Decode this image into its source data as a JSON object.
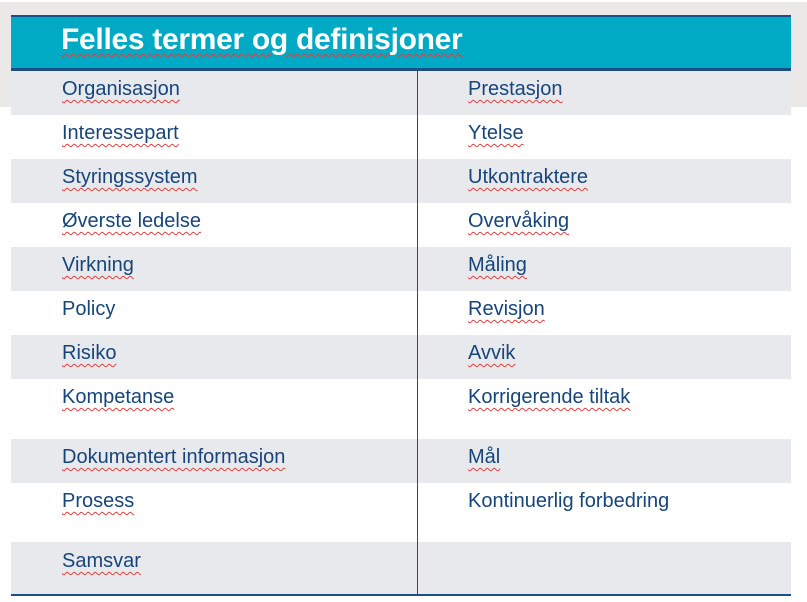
{
  "title": "Felles termer og definisjoner",
  "colors": {
    "header": "#00aac4",
    "border": "#1d4f86",
    "text": "#17457a",
    "row_alt": "#e8e9ed"
  },
  "rows": [
    {
      "left": "Organisasjon",
      "right": "Prestasjon"
    },
    {
      "left": "Interessepart",
      "right": "Ytelse"
    },
    {
      "left": "Styringssystem",
      "right": "Utkontraktere"
    },
    {
      "left": "Øverste ledelse",
      "right": "Overvåking"
    },
    {
      "left": "Virkning",
      "right": "Måling"
    },
    {
      "left": "Policy",
      "right": "Revisjon"
    },
    {
      "left": "Risiko",
      "right": "Avvik"
    },
    {
      "left": "Kompetanse",
      "right": "Korrigerende tiltak"
    },
    {
      "left": "Dokumentert informasjon",
      "right": "Mål"
    },
    {
      "left": "Prosess",
      "right": "Kontinuerlig forbedring"
    },
    {
      "left": "Samsvar",
      "right": ""
    }
  ]
}
